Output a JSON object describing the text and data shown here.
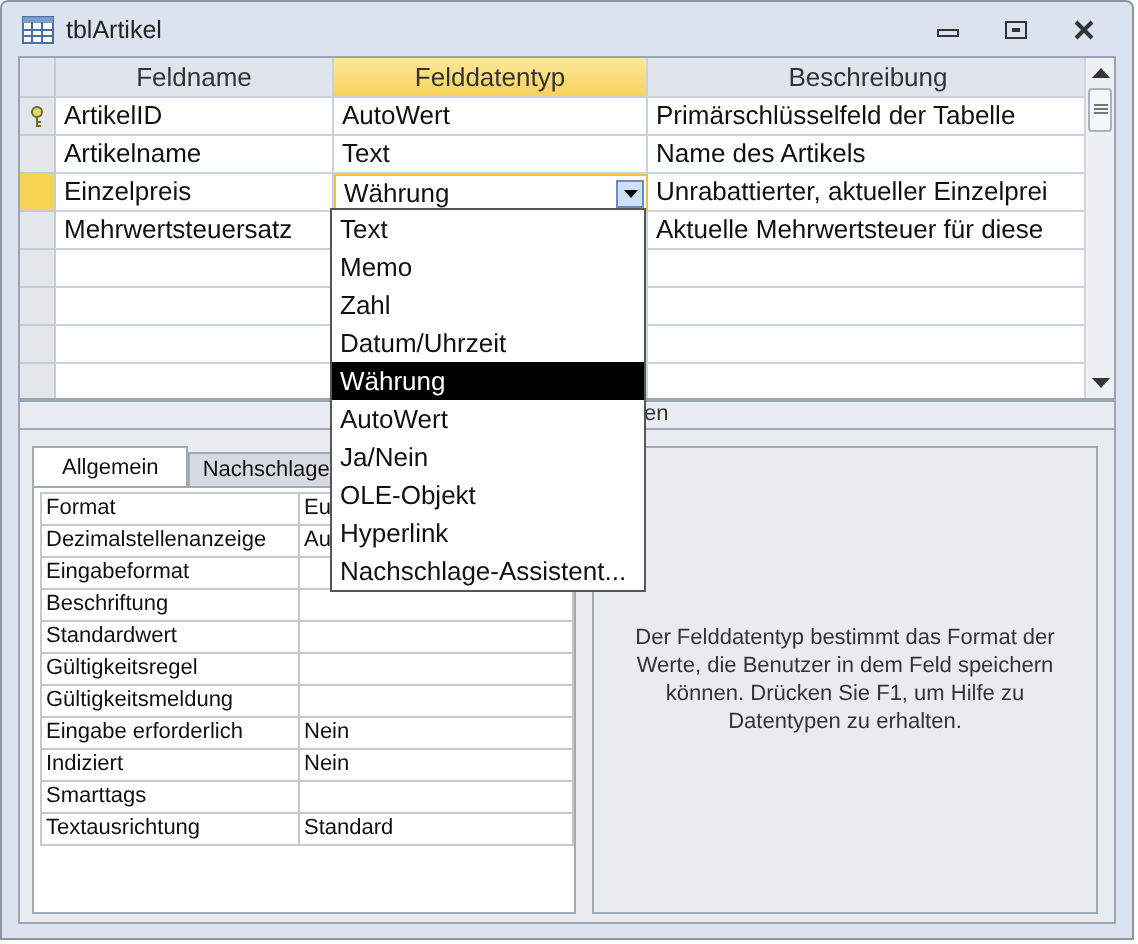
{
  "window": {
    "title": "tblArtikel"
  },
  "grid": {
    "columns": [
      {
        "label": "Feldname",
        "selected": false
      },
      {
        "label": "Felddatentyp",
        "selected": true
      },
      {
        "label": "Beschreibung",
        "selected": false
      }
    ],
    "rows": [
      {
        "name": "ArtikelID",
        "type": "AutoWert",
        "description": "Primärschlüsselfeld der Tabelle",
        "primary_key": true,
        "selected": false
      },
      {
        "name": "Artikelname",
        "type": "Text",
        "description": "Name des Artikels",
        "primary_key": false,
        "selected": false
      },
      {
        "name": "Einzelpreis",
        "type": "Währung",
        "description": "Unrabattierter, aktueller Einzelprei",
        "primary_key": false,
        "selected": true
      },
      {
        "name": "Mehrwertsteuersatz",
        "description": "Aktuelle Mehrwertsteuer für diese",
        "primary_key": false,
        "selected": false
      }
    ]
  },
  "dropdown": {
    "items": [
      {
        "label": "Text",
        "selected": false
      },
      {
        "label": "Memo",
        "selected": false
      },
      {
        "label": "Zahl",
        "selected": false
      },
      {
        "label": "Datum/Uhrzeit",
        "selected": false
      },
      {
        "label": "Währung",
        "selected": true
      },
      {
        "label": "AutoWert",
        "selected": false
      },
      {
        "label": "Ja/Nein",
        "selected": false
      },
      {
        "label": "OLE-Objekt",
        "selected": false
      },
      {
        "label": "Hyperlink",
        "selected": false
      },
      {
        "label": "Nachschlage-Assistent...",
        "selected": false
      }
    ]
  },
  "section_label": "en",
  "property_tabs": [
    {
      "label": "Allgemein",
      "selected": true
    },
    {
      "label": "Nachschlage",
      "selected": false
    }
  ],
  "properties": [
    {
      "name": "Format",
      "value": "Eu"
    },
    {
      "name": "Dezimalstellenanzeige",
      "value": "Au"
    },
    {
      "name": "Eingabeformat"
    },
    {
      "name": "Beschriftung"
    },
    {
      "name": "Standardwert"
    },
    {
      "name": "Gültigkeitsregel"
    },
    {
      "name": "Gültigkeitsmeldung"
    },
    {
      "name": "Eingabe erforderlich",
      "value": "Nein"
    },
    {
      "name": "Indiziert",
      "value": "Nein"
    },
    {
      "name": "Smarttags"
    },
    {
      "name": "Textausrichtung",
      "value": "Standard"
    }
  ],
  "help_text": "Der Felddatentyp bestimmt das Format der Werte, die Benutzer in dem Feld speichern können. Drücken Sie F1, um Hilfe zu Datentypen zu erhalten."
}
